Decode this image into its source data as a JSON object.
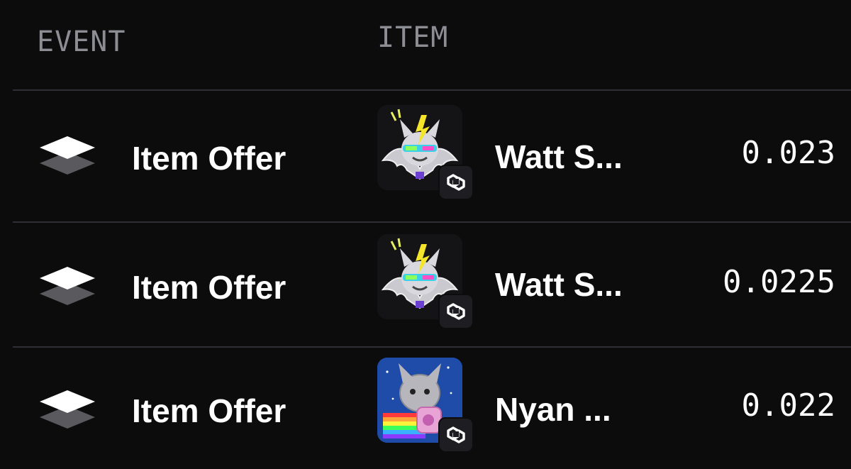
{
  "table": {
    "headers": {
      "event": "EVENT",
      "item": "ITEM"
    },
    "rows": [
      {
        "event_label": "Item Offer",
        "event_icon": "layers-icon",
        "item_name": "Watt S...",
        "item_thumbnail": "bat-nft-thumbnail",
        "chain_icon": "polygon-icon",
        "price": "0.023"
      },
      {
        "event_label": "Item Offer",
        "event_icon": "layers-icon",
        "item_name": "Watt S...",
        "item_thumbnail": "bat-nft-thumbnail",
        "chain_icon": "polygon-icon",
        "price": "0.0225"
      },
      {
        "event_label": "Item Offer",
        "event_icon": "layers-icon",
        "item_name": "Nyan ...",
        "item_thumbnail": "nyan-bat-nft-thumbnail",
        "chain_icon": "polygon-icon",
        "price": "0.022"
      }
    ]
  },
  "colors": {
    "background": "#0c0c0d",
    "header_text": "#8d8d94",
    "divider": "#2f2f36",
    "badge_bg": "#1e1e22"
  }
}
